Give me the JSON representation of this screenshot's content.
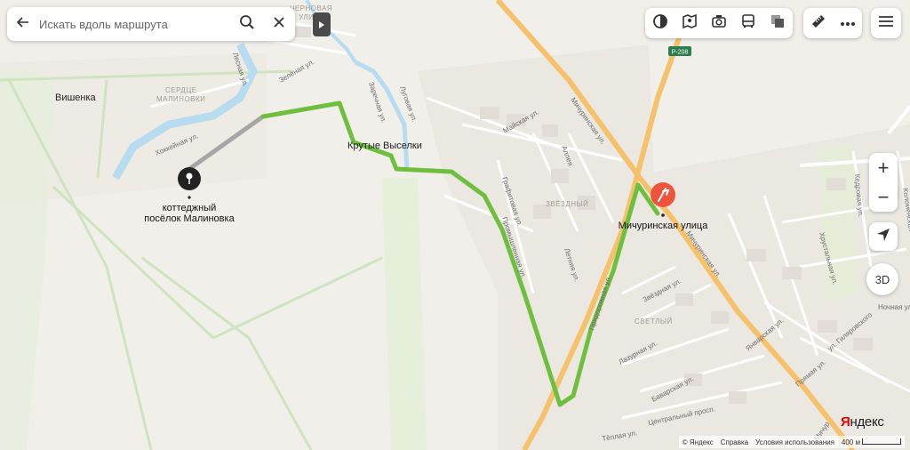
{
  "search": {
    "placeholder": "Искать вдоль маршрута"
  },
  "places": {
    "vishenka": "Вишенка",
    "serdtse_1": "СЕРДЦЕ",
    "serdtse_2": "МАЛИНОВКИ",
    "krutye": "Крутые Выселки",
    "zvezdny": "ЗВЁЗДНЫЙ",
    "svetly": "СВЕТЛЫЙ",
    "chernovaya_1": "ЧЕРНОВАЯ",
    "chernovaya_2": "УЛИЦА"
  },
  "streets": {
    "khokkeinaya": "Хоккейная ул.",
    "zelenaya": "Зелёная ул.",
    "lesnaya": "Лесная ул.",
    "zarechnaya": "Заречная ул.",
    "lugovaya": "Луговая ул.",
    "maiskaya": "Майская ул.",
    "alleya": "Аллея",
    "michurinskaya_north": "Мичуринская ул.",
    "grafitovaya": "Графитовая ул.",
    "promyshlennaya": "Промышленная ул.",
    "letnyaya": "Летняя ул.",
    "pridorozhnaya": "Придорожная ул.",
    "michurinskaya_south": "Мичуринская ул.",
    "zvezdnaya": "Звёздная ул.",
    "lazurnaya": "Лазурная ул.",
    "bavarskaya": "Баварская ул.",
    "tsentralny": "Центральный просп.",
    "teplaya": "Тёплая ул.",
    "yanvarskaya": "Январская ул.",
    "gilyarovskogo": "ул. Гиляровского",
    "pryamaya": "Прямая ул.",
    "khrustalnaya": "Хрустальная ул.",
    "kedrovaya": "Кедровая ул.",
    "kolomenskaya": "Коломенская",
    "nochnaya": "Ночная ул.",
    "michurinsk_edge": "Мичур"
  },
  "road_badge": "Р-208",
  "markers": {
    "start": {
      "label_1": "коттеджный",
      "label_2": "посёлок Малиновка"
    },
    "end": {
      "label": "Мичуринская улица"
    }
  },
  "controls": {
    "zoom_in": "+",
    "zoom_out": "−",
    "three_d": "3D"
  },
  "footer": {
    "copyright": "© Яндекс",
    "help": "Справка",
    "terms": "Условия использования",
    "scale": "400 м",
    "logo_prefix": "Я",
    "logo_rest": "ндекс"
  },
  "colors": {
    "route": "#6fbf3f",
    "route_walk": "#a6a6a6",
    "water": "#b7dcef",
    "highway": "#f5c26b",
    "marker_end": "#f0533c",
    "marker_start": "#222222"
  },
  "icons": {
    "back": "arrow-left-icon",
    "search": "search-icon",
    "clear": "close-icon",
    "layers": "layers-icon",
    "panorama": "panorama-icon",
    "photo": "camera-icon",
    "transport": "bus-icon",
    "traffic": "traffic-icon",
    "ruler": "ruler-icon",
    "more": "more-icon",
    "menu": "menu-icon",
    "location": "location-arrow-icon"
  }
}
